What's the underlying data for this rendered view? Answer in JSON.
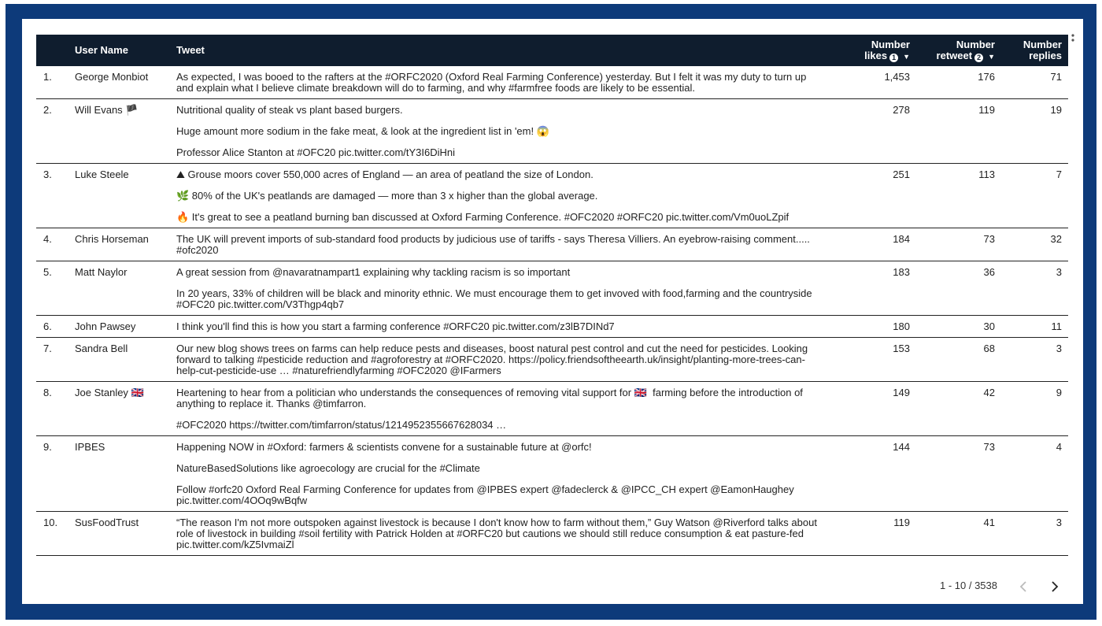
{
  "columns": {
    "idx": "",
    "user": "User Name",
    "tweet": "Tweet",
    "likes": "Number likes",
    "likes_line1": "Number",
    "likes_line2": "likes",
    "likes_sort": "1",
    "retweet_line1": "Number",
    "retweet_line2": "retweet",
    "retweet_sort": "2",
    "replies_line1": "Number",
    "replies_line2": "replies"
  },
  "rows": [
    {
      "idx": "1.",
      "user": "George Monbiot",
      "tweet": [
        "As expected, I was booed to the rafters at the #ORFC2020 (Oxford Real Farming Conference) yesterday. But I felt it was my duty to turn up and explain what I believe climate breakdown will do to farming, and why #farmfree foods are likely to be essential."
      ],
      "likes": "1,453",
      "retweet": "176",
      "replies": "71"
    },
    {
      "idx": "2.",
      "user": "Will Evans 🏴",
      "tweet": [
        "Nutritional quality of steak vs plant based burgers.",
        "Huge amount more sodium in the fake meat, & look at the ingredient list in 'em! 😱",
        "Professor Alice Stanton at #OFC20 pic.twitter.com/tY3I6DiHni"
      ],
      "likes": "278",
      "retweet": "119",
      "replies": "19"
    },
    {
      "idx": "3.",
      "user": "Luke Steele",
      "tweet": [
        "⛰ Grouse moors cover 550,000 acres of England — an area of peatland the size of London.",
        "🌿 80% of the UK's peatlands are damaged — more than 3 x higher than the global average.",
        "🔥 It's great to see a peatland burning ban discussed at Oxford Farming Conference. #OFC2020 #ORFC20 pic.twitter.com/Vm0uoLZpif"
      ],
      "likes": "251",
      "retweet": "113",
      "replies": "7"
    },
    {
      "idx": "4.",
      "user": "Chris Horseman",
      "tweet": [
        "The UK will prevent imports of sub-standard food products by judicious use of tariffs - says Theresa Villiers. An eyebrow-raising comment..... #ofc2020"
      ],
      "likes": "184",
      "retweet": "73",
      "replies": "32"
    },
    {
      "idx": "5.",
      "user": "Matt Naylor",
      "tweet": [
        "A great session from @navaratnampart1 explaining why tackling racism is so important",
        "In 20 years, 33% of children will be black and minority ethnic. We must encourage them to get invoved with food,farming and the countryside #OFC20 pic.twitter.com/V3Thgp4qb7"
      ],
      "likes": "183",
      "retweet": "36",
      "replies": "3"
    },
    {
      "idx": "6.",
      "user": "John Pawsey",
      "tweet": [
        "I think you'll find this is how you start a farming conference #ORFC20 pic.twitter.com/z3lB7DINd7"
      ],
      "likes": "180",
      "retweet": "30",
      "replies": "11"
    },
    {
      "idx": "7.",
      "user": "Sandra Bell",
      "tweet": [
        "Our new blog shows trees on farms can help reduce pests and diseases, boost natural pest control and cut the need for pesticides. Looking forward to talking #pesticide reduction and #agroforestry at #ORFC2020. https://policy.friendsoftheearth.uk/insight/planting-more-trees-can-help-cut-pesticide-use … #naturefriendlyfarming #OFC2020 @IFarmers"
      ],
      "likes": "153",
      "retweet": "68",
      "replies": "3"
    },
    {
      "idx": "8.",
      "user": "Joe Stanley 🇬🇧",
      "tweet": [
        "Heartening to hear from a politician who understands the consequences of removing vital support for 🇬🇧  farming before the introduction of anything to replace it. Thanks @timfarron.",
        "#OFC2020 https://twitter.com/timfarron/status/1214952355667628034 …"
      ],
      "likes": "149",
      "retweet": "42",
      "replies": "9"
    },
    {
      "idx": "9.",
      "user": "IPBES",
      "tweet": [
        "Happening NOW in #Oxford: farmers & scientists convene for a sustainable future at @orfc!",
        "NatureBasedSolutions like agroecology are crucial for the #Climate",
        "Follow #orfc20 Oxford Real Farming Conference for updates from @IPBES expert @fadeclerck & @IPCC_CH expert @EamonHaughey pic.twitter.com/4OOq9wBqfw"
      ],
      "likes": "144",
      "retweet": "73",
      "replies": "4"
    },
    {
      "idx": "10.",
      "user": "SusFoodTrust",
      "tweet": [
        "“The reason I'm not more outspoken against livestock is because I don't know how to farm without them,” Guy Watson @Riverford talks about role of livestock in building #soil fertility with Patrick Holden at #ORFC20 but cautions we should still reduce consumption & eat pasture-fed pic.twitter.com/kZ5IvmaiZl"
      ],
      "likes": "119",
      "retweet": "41",
      "replies": "3"
    }
  ],
  "pagination": {
    "range": "1 - 10 / 3538"
  },
  "icons": {
    "menu": "more-vert-icon",
    "prev": "chevron-left-icon",
    "next": "chevron-right-icon"
  },
  "colors": {
    "frame": "#0d3a7a",
    "header_bg": "#0f1d2e"
  }
}
